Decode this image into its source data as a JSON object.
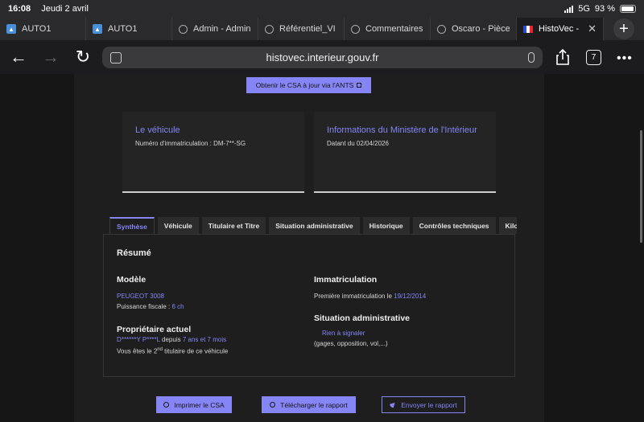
{
  "status": {
    "time": "16:08",
    "date": "Jeudi 2 avril",
    "network": "5G",
    "battery": "93 %"
  },
  "browser": {
    "tabs": [
      {
        "label": "AUTO1",
        "icon": "auto1-icon"
      },
      {
        "label": "AUTO1",
        "icon": "auto1-icon"
      },
      {
        "label": "Admin - Admin",
        "icon": "globe-icon"
      },
      {
        "label": "Référentiel_VI",
        "icon": "globe-icon"
      },
      {
        "label": "Commentaires",
        "icon": "globe-icon"
      },
      {
        "label": "Oscaro - Pièce",
        "icon": "globe-icon"
      },
      {
        "label": "HistoVec -",
        "icon": "french-flag-icon"
      }
    ],
    "url": "histovec.interieur.gouv.fr",
    "tab_count": "7"
  },
  "page": {
    "ants_button": "Obtenir le CSA à jour via l'ANTS",
    "vehicle_card": {
      "title": "Le véhicule",
      "text": "Numéro d'immatriculation : DM-7**-SG"
    },
    "ministry_card": {
      "title": "Informations du Ministère de l'Intérieur",
      "text": "Datant du 02/04/2026"
    },
    "tabs": [
      "Synthèse",
      "Véhicule",
      "Titulaire et Titre",
      "Situation administrative",
      "Historique",
      "Contrôles techniques",
      "Kilo"
    ],
    "summary": {
      "title": "Résumé",
      "model_heading": "Modèle",
      "model": "PEUGEOT 3008",
      "power_label": "Puissance fiscale : ",
      "power_value": "6 ch",
      "owner_heading": "Propriétaire actuel",
      "owner_name": "D******Y P****L",
      "owner_since_label": " depuis ",
      "owner_since": "7 ans et 7 mois",
      "owner_rank_pre": "Vous êtes le ",
      "owner_rank_num": "2",
      "owner_rank_sup": "nd",
      "owner_rank_post": " titulaire de ce véhicule",
      "registration_heading": "Immatriculation",
      "first_registration_label": "Première immatriculation le ",
      "first_registration_date": "19/12/2014",
      "admin_heading": "Situation administrative",
      "admin_status": "Rien à signaler",
      "admin_detail": "(gages, opposition, vol,...)"
    },
    "actions": {
      "print": "Imprimer le CSA",
      "download": "Télécharger le rapport",
      "send": "Envoyer le rapport"
    }
  },
  "colors": {
    "accent": "#8585f6",
    "background": "#1e1e1e"
  }
}
